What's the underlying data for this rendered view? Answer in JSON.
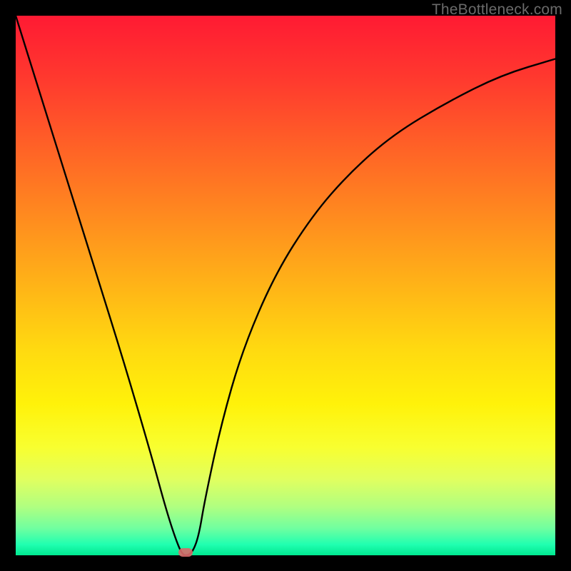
{
  "watermark": "TheBottleneck.com",
  "chart_data": {
    "type": "line",
    "title": "",
    "xlabel": "",
    "ylabel": "",
    "xlim": [
      0,
      100
    ],
    "ylim": [
      0,
      100
    ],
    "series": [
      {
        "name": "curve",
        "x": [
          0,
          5,
          10,
          15,
          20,
          25,
          28,
          30,
          31,
          32,
          33,
          34,
          35,
          38,
          42,
          48,
          55,
          62,
          70,
          80,
          90,
          100
        ],
        "values": [
          100,
          84,
          68,
          52,
          36,
          19,
          8,
          2,
          0,
          0,
          1,
          4,
          10,
          24,
          38,
          52,
          63,
          71,
          78,
          84,
          89,
          92
        ]
      }
    ],
    "marker": {
      "x": 31.5,
      "y": 0
    },
    "background": "red-yellow-green vertical gradient",
    "grid": false,
    "legend": false
  }
}
